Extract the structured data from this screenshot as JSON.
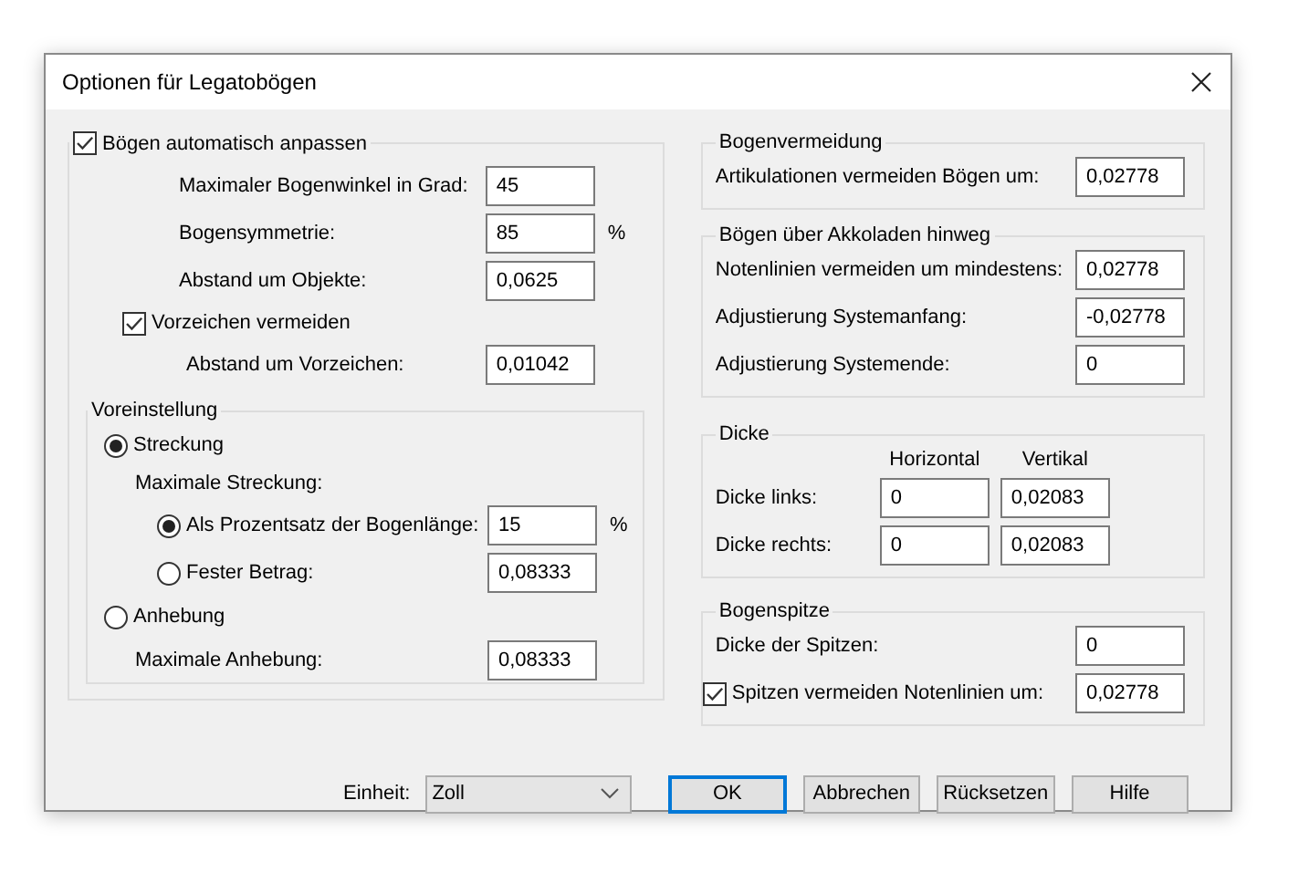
{
  "window": {
    "title": "Optionen für Legatobögen"
  },
  "auto_group": {
    "label": "Bögen automatisch anpassen",
    "checked": true,
    "rows": [
      {
        "kind": "field",
        "label": "Maximaler Bogenwinkel in Grad:",
        "value": "45"
      },
      {
        "kind": "field",
        "label": "Bogensymmetrie:",
        "value": "85",
        "unit": "%"
      },
      {
        "kind": "field",
        "label": "Abstand um Objekte:",
        "value": "0,0625"
      },
      {
        "kind": "checkbox",
        "label": "Vorzeichen vermeiden",
        "checked": true
      },
      {
        "kind": "subfield",
        "label": "Abstand um Vorzeichen:",
        "value": "0,01042"
      }
    ]
  },
  "preset": {
    "title": "Voreinstellung",
    "rows": [
      {
        "kind": "radio",
        "label": "Streckung",
        "selected": true
      },
      {
        "kind": "text",
        "label": "Maximale Streckung:"
      },
      {
        "kind": "radio_field",
        "label": "Als Prozentsatz der Bogenlänge:",
        "selected": true,
        "value": "15",
        "unit": "%"
      },
      {
        "kind": "radio_field",
        "label": "Fester Betrag:",
        "selected": false,
        "value": "0,08333"
      },
      {
        "kind": "radio",
        "label": "Anhebung",
        "selected": false
      },
      {
        "kind": "field",
        "label": "Maximale Anhebung:",
        "value": "0,08333"
      }
    ]
  },
  "right_groups": [
    {
      "title": "Bogenvermeidung",
      "rows": [
        {
          "kind": "field",
          "label": "Artikulationen vermeiden Bögen um:",
          "value": "0,02778"
        }
      ]
    },
    {
      "title": "Bögen über Akkoladen hinweg",
      "rows": [
        {
          "kind": "field",
          "label": "Notenlinien vermeiden um mindestens:",
          "value": "0,02778"
        },
        {
          "kind": "field",
          "label": "Adjustierung Systemanfang:",
          "value": "-0,02778"
        },
        {
          "kind": "field",
          "label": "Adjustierung Systemende:",
          "value": "0"
        }
      ]
    },
    {
      "title": "Dicke",
      "rows": [
        {
          "kind": "header",
          "columns": [
            "Horizontal",
            "Vertikal"
          ]
        },
        {
          "kind": "pair",
          "label": "Dicke links:",
          "values": [
            "0",
            "0,02083"
          ]
        },
        {
          "kind": "pair",
          "label": "Dicke rechts:",
          "values": [
            "0",
            "0,02083"
          ]
        }
      ]
    },
    {
      "title": "Bogenspitze",
      "rows": [
        {
          "kind": "field",
          "label": "Dicke der Spitzen:",
          "value": "0"
        },
        {
          "kind": "checkbox_field",
          "label": "Spitzen vermeiden Notenlinien um:",
          "checked": true,
          "value": "0,02778"
        }
      ]
    }
  ],
  "unit": {
    "label": "Einheit:",
    "value": "Zoll"
  },
  "buttons": [
    {
      "label": "OK",
      "default": true
    },
    {
      "label": "Abbrechen",
      "default": false
    },
    {
      "label": "Rücksetzen",
      "default": false
    },
    {
      "label": "Hilfe",
      "default": false
    }
  ]
}
